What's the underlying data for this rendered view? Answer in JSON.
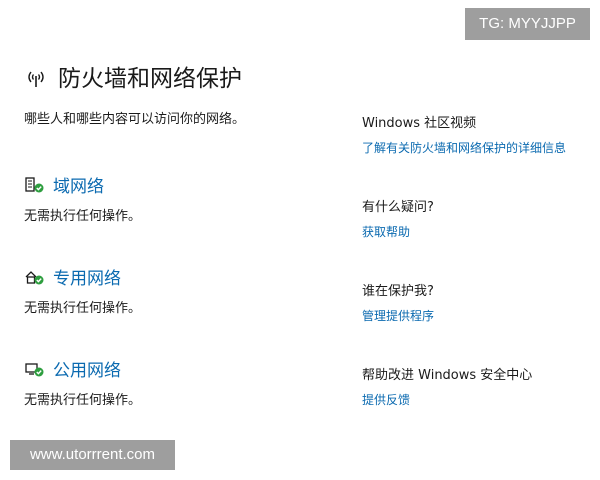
{
  "watermarks": {
    "top": "TG: MYYJJPP",
    "bottom": "www.utorrrent.com"
  },
  "header": {
    "title": "防火墙和网络保护",
    "subtitle": "哪些人和哪些内容可以访问你的网络。",
    "icon": "antenna-icon"
  },
  "networks": [
    {
      "label": "域网络",
      "status": "无需执行任何操作。",
      "icon": "domain-network-icon"
    },
    {
      "label": "专用网络",
      "status": "无需执行任何操作。",
      "icon": "private-network-icon"
    },
    {
      "label": "公用网络",
      "status": "无需执行任何操作。",
      "icon": "public-network-icon"
    }
  ],
  "sidebar": [
    {
      "title": "Windows 社区视频",
      "link": "了解有关防火墙和网络保护的详细信息"
    },
    {
      "title": "有什么疑问?",
      "link": "获取帮助"
    },
    {
      "title": "谁在保护我?",
      "link": "管理提供程序"
    },
    {
      "title": "帮助改进 Windows 安全中心",
      "link": "提供反馈"
    }
  ],
  "colors": {
    "link": "#0b6ab0",
    "status_ok": "#2e9e3f",
    "watermark_bg": "#9e9e9e"
  }
}
